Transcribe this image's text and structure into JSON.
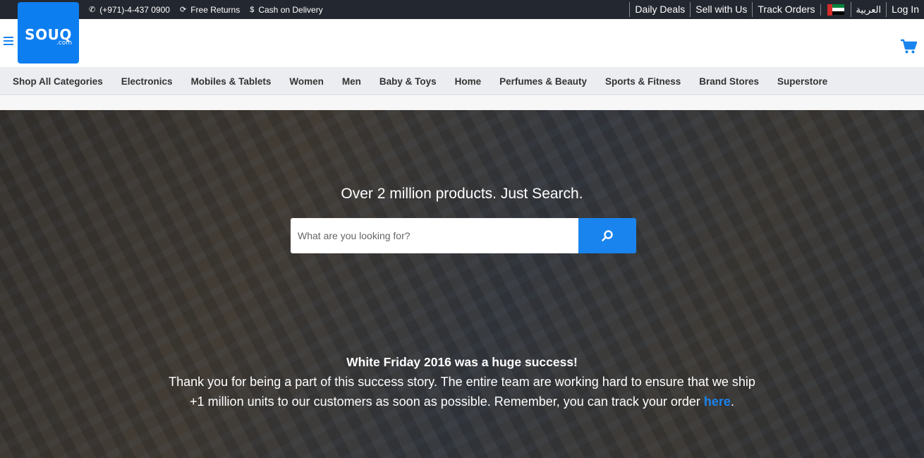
{
  "topbar": {
    "phone": "(+971)-4-437 0900",
    "returns": "Free Returns",
    "cod": "Cash on Delivery",
    "links": {
      "daily_deals": "Daily Deals",
      "sell": "Sell with Us",
      "track": "Track Orders",
      "arabic": "العربية",
      "login": "Log In"
    }
  },
  "logo": {
    "word": "SOUQ",
    "suffix": ".com"
  },
  "categories": [
    "Shop All Categories",
    "Electronics",
    "Mobiles & Tablets",
    "Women",
    "Men",
    "Baby & Toys",
    "Home",
    "Perfumes & Beauty",
    "Sports & Fitness",
    "Brand Stores",
    "Superstore"
  ],
  "hero": {
    "tagline": "Over 2 million products. Just Search.",
    "search_placeholder": "What are you looking for?",
    "headline": "White Friday 2016 was a huge success!",
    "body_line1": "Thank you for being a part of this success story. The entire team are working hard to ensure that we ship",
    "body_line2": "+1 million units to our customers as soon as possible. Remember, you can track your order ",
    "link_text": "here",
    "body_end": "."
  },
  "colors": {
    "brand_blue": "#1a84ee",
    "topbar_bg": "#23272f",
    "nav_bg": "#ebedf0"
  },
  "icons": [
    "phone-icon",
    "refresh-icon",
    "dollar-icon",
    "uae-flag-icon",
    "hamburger-icon",
    "cart-icon",
    "search-icon"
  ]
}
